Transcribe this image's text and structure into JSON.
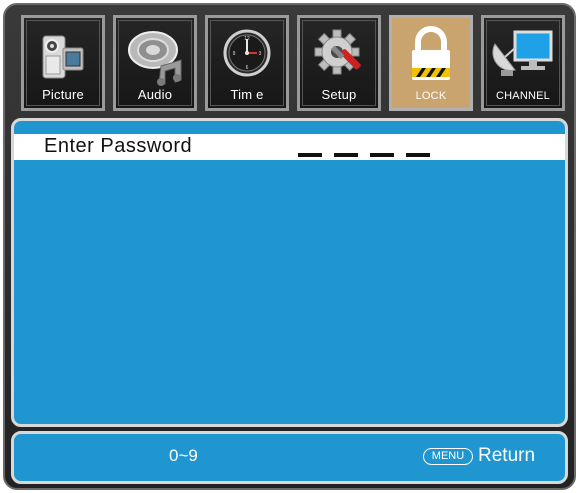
{
  "tabs": [
    {
      "label": "Picture",
      "icon": "picture-camera-icon",
      "active": false
    },
    {
      "label": "Audio",
      "icon": "audio-speaker-icon",
      "active": false
    },
    {
      "label": "Tim e",
      "icon": "clock-icon",
      "active": false
    },
    {
      "label": "Setup",
      "icon": "gear-wrench-icon",
      "active": false
    },
    {
      "label": "LOCK",
      "icon": "padlock-icon",
      "active": true
    },
    {
      "label": "CHANNEL",
      "icon": "satellite-monitor-icon",
      "active": false
    }
  ],
  "main": {
    "password_label": "Enter Password",
    "password_length": 4,
    "password_value": ""
  },
  "footer": {
    "digits_hint": "0~9",
    "menu_key": "MENU",
    "return_label": "Return"
  },
  "colors": {
    "panel_blue": "#1f96cf",
    "active_tab": "#c9a46e",
    "frame_dark": "#2a2a2a"
  }
}
